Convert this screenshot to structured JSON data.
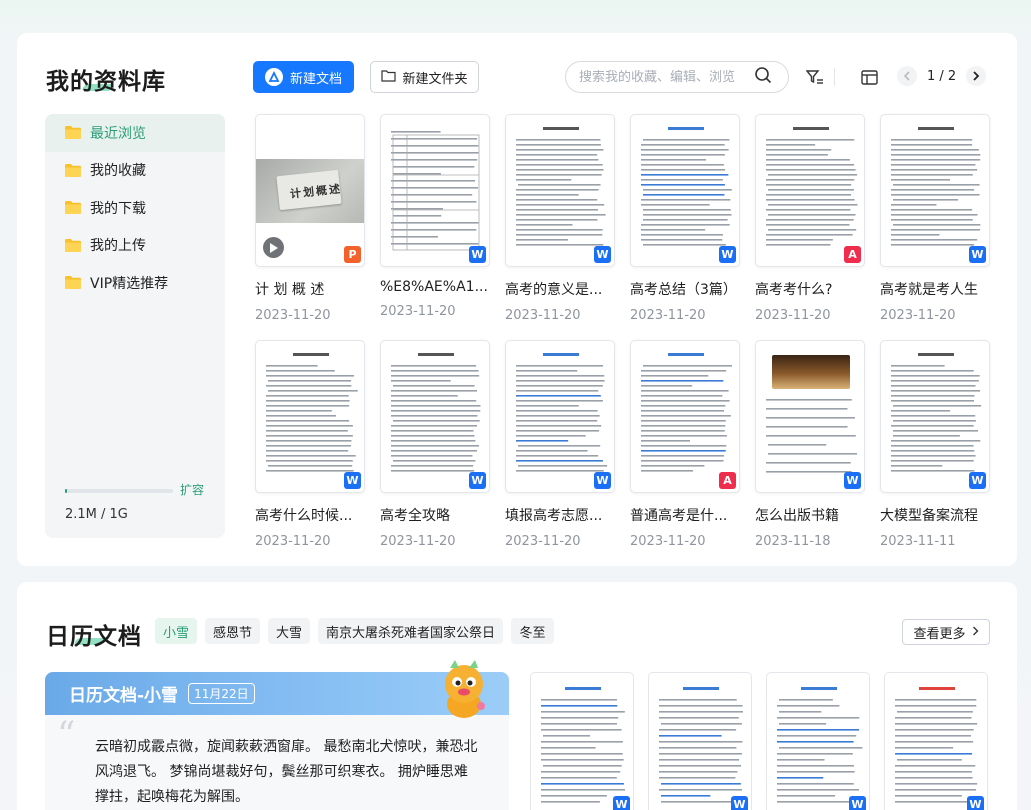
{
  "library": {
    "title": "我的资料库",
    "new_doc_label": "新建文档",
    "new_folder_label": "新建文件夹",
    "search_placeholder": "搜索我的收藏、编辑、浏览",
    "page_indicator": "1 / 2",
    "sidebar": [
      {
        "label": "最近浏览",
        "active": true
      },
      {
        "label": "我的收藏",
        "active": false
      },
      {
        "label": "我的下载",
        "active": false
      },
      {
        "label": "我的上传",
        "active": false
      },
      {
        "label": "VIP精选推荐",
        "active": false
      }
    ],
    "storage": {
      "text": "2.1M / 1G",
      "expand_label": "扩容",
      "used_fraction": 0.002
    },
    "docs": [
      {
        "title": "计 划 概 述",
        "date": "2023-11-20",
        "type": "ppt",
        "badge": "P",
        "thumb_text": "计划概述"
      },
      {
        "title": "%E8%AE%A1...",
        "date": "2023-11-20",
        "type": "word",
        "badge": "W"
      },
      {
        "title": "高考的意义是...",
        "date": "2023-11-20",
        "type": "word",
        "badge": "W"
      },
      {
        "title": "高考总结（3篇）",
        "date": "2023-11-20",
        "type": "word",
        "badge": "W"
      },
      {
        "title": "高考考什么?",
        "date": "2023-11-20",
        "type": "pdf",
        "badge": "A"
      },
      {
        "title": "高考就是考人生",
        "date": "2023-11-20",
        "type": "word",
        "badge": "W"
      },
      {
        "title": "高考什么时候...",
        "date": "2023-11-20",
        "type": "word",
        "badge": "W"
      },
      {
        "title": "高考全攻略",
        "date": "2023-11-20",
        "type": "word",
        "badge": "W"
      },
      {
        "title": "填报高考志愿...",
        "date": "2023-11-20",
        "type": "word",
        "badge": "W"
      },
      {
        "title": "普通高考是什...",
        "date": "2023-11-20",
        "type": "pdf",
        "badge": "A"
      },
      {
        "title": "怎么出版书籍",
        "date": "2023-11-18",
        "type": "word",
        "badge": "W"
      },
      {
        "title": "大模型备案流程",
        "date": "2023-11-11",
        "type": "word",
        "badge": "W"
      }
    ]
  },
  "calendar": {
    "title": "日历文档",
    "tags": [
      {
        "label": "小雪",
        "active": true
      },
      {
        "label": "感恩节",
        "active": false
      },
      {
        "label": "大雪",
        "active": false
      },
      {
        "label": "南京大屠杀死难者国家公祭日",
        "active": false
      },
      {
        "label": "冬至",
        "active": false
      }
    ],
    "more_label": "查看更多",
    "hero_title": "日历文档-小雪",
    "hero_date": "11月22日",
    "poem": "云暗初成霰点微，旋闻蔌蔌洒窗扉。 最愁南北犬惊吠，兼恐北风鸿退飞。 梦锦尚堪裁好句，鬓丝那可织寒衣。 拥炉睡思难撑拄，起唤梅花为解围。",
    "docs": [
      {
        "badge": "W"
      },
      {
        "badge": "W"
      },
      {
        "badge": "W"
      },
      {
        "badge": "W"
      }
    ]
  },
  "colors": {
    "primary": "#1677ff",
    "accent": "#2a9d77",
    "word": "#1a6ff5",
    "pdf": "#ef2d4d",
    "ppt": "#f2622a"
  }
}
